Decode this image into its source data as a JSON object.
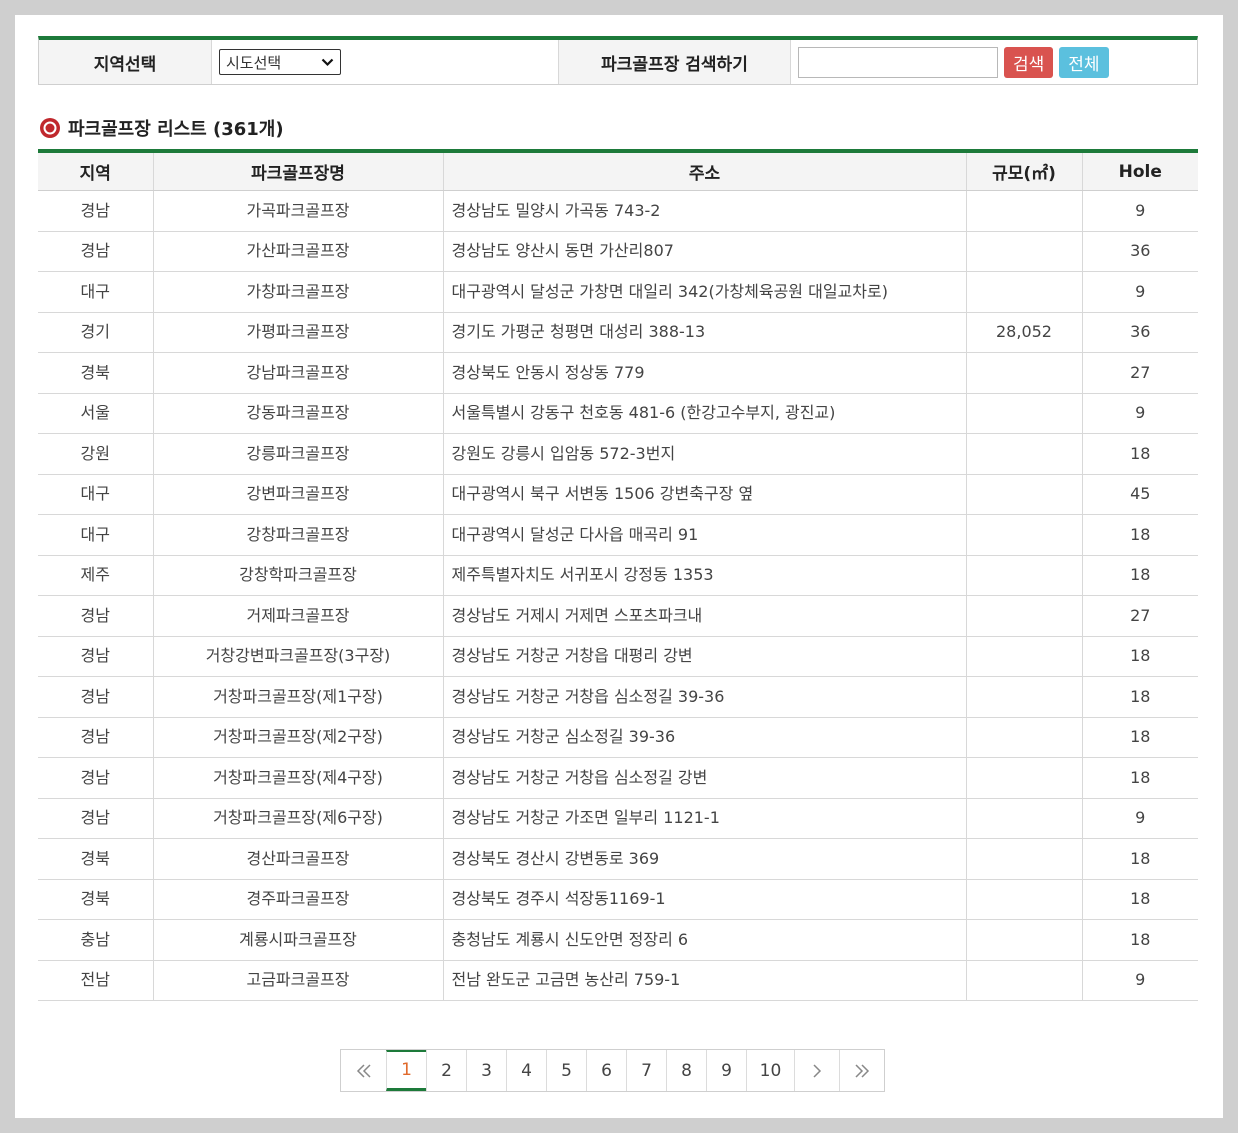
{
  "search": {
    "region_label": "지역선택",
    "region_select_value": "시도선택",
    "search_label": "파크골프장 검색하기",
    "search_input_value": "",
    "search_button": "검색",
    "all_button": "전체"
  },
  "list": {
    "title": "파크골프장 리스트 (361개)"
  },
  "table": {
    "headers": [
      "지역",
      "파크골프장명",
      "주소",
      "규모(㎡)",
      "Hole"
    ],
    "rows": [
      [
        "경남",
        "가곡파크골프장",
        "경상남도 밀양시 가곡동 743-2",
        "",
        "9"
      ],
      [
        "경남",
        "가산파크골프장",
        "경상남도 양산시 동면 가산리807",
        "",
        "36"
      ],
      [
        "대구",
        "가창파크골프장",
        "대구광역시 달성군 가창면 대일리 342(가창체육공원 대일교차로)",
        "",
        "9"
      ],
      [
        "경기",
        "가평파크골프장",
        "경기도 가평군 청평면 대성리 388-13",
        "28,052",
        "36"
      ],
      [
        "경북",
        "강남파크골프장",
        "경상북도 안동시 정상동 779",
        "",
        "27"
      ],
      [
        "서울",
        "강동파크골프장",
        "서울특별시 강동구 천호동 481-6 (한강고수부지, 광진교)",
        "",
        "9"
      ],
      [
        "강원",
        "강릉파크골프장",
        "강원도 강릉시 입암동 572-3번지",
        "",
        "18"
      ],
      [
        "대구",
        "강변파크골프장",
        "대구광역시 북구 서변동 1506 강변축구장 옆",
        "",
        "45"
      ],
      [
        "대구",
        "강창파크골프장",
        "대구광역시 달성군 다사읍 매곡리 91",
        "",
        "18"
      ],
      [
        "제주",
        "강창학파크골프장",
        "제주특별자치도 서귀포시 강정동 1353",
        "",
        "18"
      ],
      [
        "경남",
        "거제파크골프장",
        "경상남도 거제시 거제면 스포츠파크내",
        "",
        "27"
      ],
      [
        "경남",
        "거창강변파크골프장(3구장)",
        "경상남도 거창군 거창읍 대평리 강변",
        "",
        "18"
      ],
      [
        "경남",
        "거창파크골프장(제1구장)",
        "경상남도 거창군 거창읍 심소정길 39-36",
        "",
        "18"
      ],
      [
        "경남",
        "거창파크골프장(제2구장)",
        "경상남도 거창군 심소정길 39-36",
        "",
        "18"
      ],
      [
        "경남",
        "거창파크골프장(제4구장)",
        "경상남도 거창군 거창읍 심소정길 강변",
        "",
        "18"
      ],
      [
        "경남",
        "거창파크골프장(제6구장)",
        "경상남도 거창군 가조면 일부리 1121-1",
        "",
        "9"
      ],
      [
        "경북",
        "경산파크골프장",
        "경상북도 경산시 강변동로 369",
        "",
        "18"
      ],
      [
        "경북",
        "경주파크골프장",
        "경상북도 경주시 석장동1169-1",
        "",
        "18"
      ],
      [
        "충남",
        "계룡시파크골프장",
        "충청남도 계룡시 신도안면 정장리 6",
        "",
        "18"
      ],
      [
        "전남",
        "고금파크골프장",
        "전남 완도군 고금면 농산리 759-1",
        "",
        "9"
      ]
    ]
  },
  "pagination": {
    "pages": [
      "1",
      "2",
      "3",
      "4",
      "5",
      "6",
      "7",
      "8",
      "9",
      "10"
    ],
    "current": "1"
  },
  "colors": {
    "accent_green": "#1d7a3a",
    "search_red": "#d9534f",
    "all_blue": "#5bc0de",
    "active_page": "#e06a2c"
  }
}
